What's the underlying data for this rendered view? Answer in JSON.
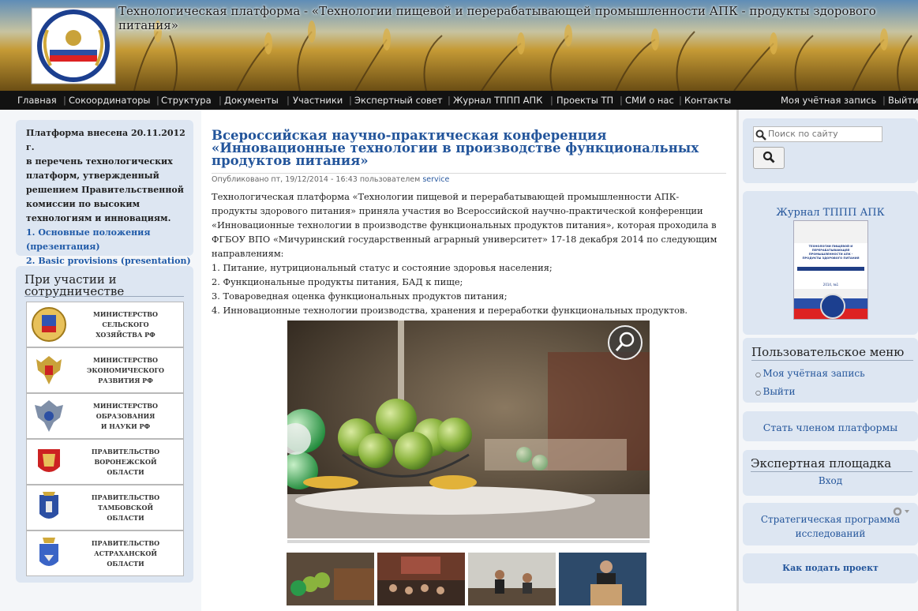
{
  "header": {
    "site_title": "Технологическая платформа - «Технологии пищевой и перерабатывающей промышленности АПК - продукты здорового питания»"
  },
  "nav": {
    "items": [
      "Главная",
      "Сокоординаторы",
      "Структура",
      "Документы",
      "Участники",
      "Экспертный совет",
      "Журнал ТППП АПК",
      "Проекты ТП",
      "СМИ о нас",
      "Контакты"
    ],
    "account": "Моя учётная запись",
    "logout": "Выйти"
  },
  "sidebar_left": {
    "intro_lines": [
      "Платформа внесена 20.11.2012 г.",
      "в перечень технологических",
      "платформ, утвержденный",
      "решением Правительственной",
      "комиссии по высоким",
      "технологиям и инновациям."
    ],
    "link1_line1": "1. Основные положения",
    "link1_line2": "(презентация)",
    "link2": "2. Basic provisions (presentation)",
    "partners_title_line1": "При участии и",
    "partners_title_line2": "сотрудничестве",
    "partners": [
      {
        "lines": [
          "МИНИСТЕРСТВО СЕЛЬСКОГО",
          "ХОЗЯЙСТВА РФ"
        ]
      },
      {
        "lines": [
          "МИНИСТЕРСТВО",
          "ЭКОНОМИЧЕСКОГО",
          "РАЗВИТИЯ РФ"
        ]
      },
      {
        "lines": [
          "МИНИСТЕРСТВО",
          "ОБРАЗОВАНИЯ",
          "И НАУКИ РФ"
        ]
      },
      {
        "lines": [
          "ПРАВИТЕЛЬСТВО",
          "ВОРОНЕЖСКОЙ",
          "ОБЛАСТИ"
        ]
      },
      {
        "lines": [
          "ПРАВИТЕЛЬСТВО",
          "ТАМБОВСКОЙ",
          "ОБЛАСТИ"
        ]
      },
      {
        "lines": [
          "ПРАВИТЕЛЬСТВО",
          "АСТРАХАНСКОЙ",
          "ОБЛАСТИ"
        ]
      }
    ]
  },
  "article": {
    "title_line1": "Всероссийская научно-практическая конференция",
    "title_line2": "«Инновационные технологии в производстве функциональных",
    "title_line3": "продуктов питания»",
    "meta_prefix": "Опубликовано пт, 19/12/2014 - 16:43 пользователем",
    "meta_user": "service",
    "paragraph_lines": [
      "Технологическая платформа «Технологии пищевой и перерабатывающей промышленности АПК-",
      "продукты здорового питания» приняла участия во Всероссийской научно-практической конференции",
      "«Инновационные технологии в производстве функциональных продуктов питания», которая проходила в",
      "ФГБОУ ВПО «Мичуринский государственный аграрный университет» 17-18 декабря 2014 по следующим",
      "направлениям:"
    ],
    "list": [
      "1. Питание, нутрициональный статус и состояние здоровья населения;",
      "2. Функциональные продукты питания, БАД к пище;",
      "3. Товароведная оценка функциональных продуктов питания;",
      "4. Инновационные технологии производства, хранения и переработки функциональных продуктов."
    ]
  },
  "sidebar_right": {
    "search_placeholder": "Поиск по сайту",
    "journal_title": "Журнал ТППП АПК",
    "journal_cover_lines": [
      "ТЕХНОЛОГИИ ПИЩЕВОЙ И",
      "ПЕРЕРАБАТЫВАЮЩЕЙ",
      "ПРОМЫШЛЕННОСТИ АПК -",
      "ПРОДУКТЫ ЗДОРОВОГО ПИТАНИЯ",
      "2014, №1"
    ],
    "user_menu_title": "Пользовательское меню",
    "user_menu": [
      "Моя учётная запись",
      "Выйти"
    ],
    "become_member": "Стать членом платформы",
    "expert_title": "Экспертная площадка",
    "expert_login": "Вход",
    "strategic_line1": "Стратегическая программа",
    "strategic_line2": "исследований",
    "how_to_submit": "Как подать проект"
  },
  "colors": {
    "link": "#23559b",
    "nav_bg": "#121212",
    "block_bg": "#dde6f2"
  }
}
